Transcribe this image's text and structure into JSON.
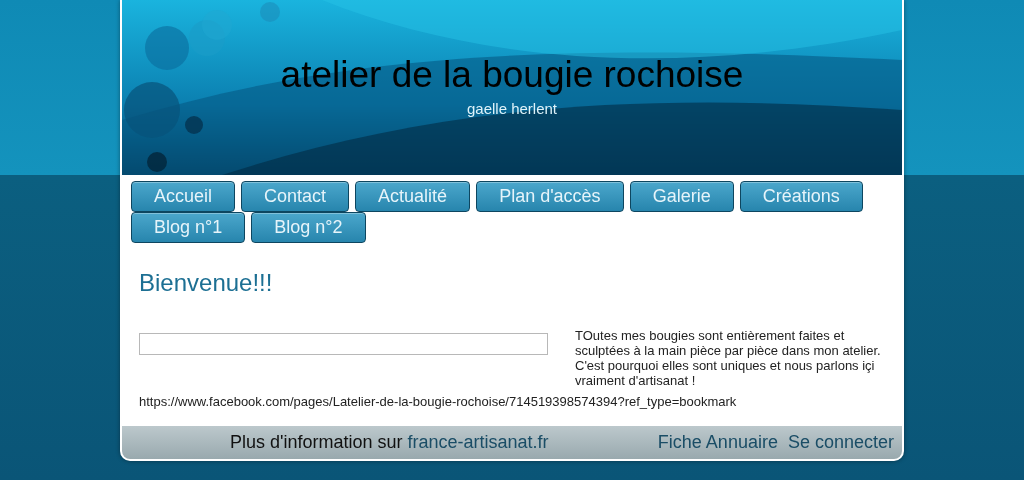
{
  "header": {
    "title": "atelier de la bougie rochoise",
    "subtitle": "gaelle herlent"
  },
  "nav": [
    {
      "label": "Accueil"
    },
    {
      "label": "Contact"
    },
    {
      "label": "Actualité"
    },
    {
      "label": "Plan d'accès"
    },
    {
      "label": "Galerie"
    },
    {
      "label": "Créations"
    },
    {
      "label": "Blog n°1"
    },
    {
      "label": "Blog n°2"
    }
  ],
  "content": {
    "heading": "Bienvenue!!!",
    "paragraph": "TOutes mes bougies sont entièrement faites et sculptées à la main pièce par pièce dans mon atelier. C'est pourquoi elles sont uniques et nous parlons içi vraiment d'artisanat !",
    "url": "https://www.facebook.com/pages/Latelier-de-la-bougie-rochoise/714519398574394?ref_type=bookmark"
  },
  "footer": {
    "info_text": "Plus d'information sur",
    "info_link": "france-artisanat.fr",
    "links": [
      "Fiche Annuaire",
      "Se connecter"
    ]
  }
}
